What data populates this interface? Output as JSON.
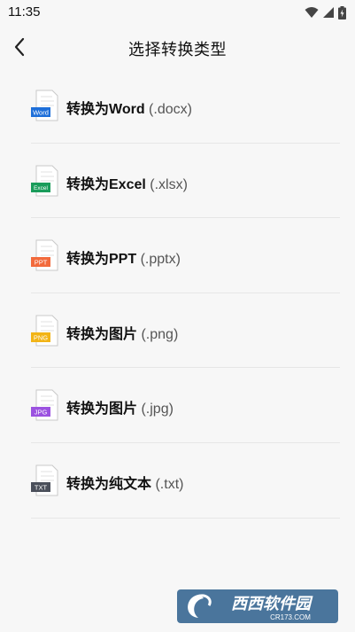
{
  "status_bar": {
    "time": "11:35",
    "icons": [
      "wifi-icon",
      "cellular-signal-icon",
      "battery-charging-icon"
    ]
  },
  "app_bar": {
    "back_icon": "chevron-left-icon",
    "title": "选择转换类型"
  },
  "items": [
    {
      "label": "转换为Word",
      "ext": "(.docx)",
      "badge": "Word",
      "color": "#1e6fd9"
    },
    {
      "label": "转换为Excel",
      "ext": "(.xlsx)",
      "badge": "Excel",
      "color": "#1a9c5b"
    },
    {
      "label": "转换为PPT",
      "ext": "(.pptx)",
      "badge": "PPT",
      "color": "#f26a3c"
    },
    {
      "label": "转换为图片",
      "ext": "(.png)",
      "badge": "PNG",
      "color": "#f2b416"
    },
    {
      "label": "转换为图片",
      "ext": "(.jpg)",
      "badge": "JPG",
      "color": "#9b52e0"
    },
    {
      "label": "转换为纯文本",
      "ext": "(.txt)",
      "badge": "TXT",
      "color": "#4a4f5a"
    }
  ],
  "watermark": {
    "text": "西西软件园",
    "subtext": "CR173.COM"
  }
}
